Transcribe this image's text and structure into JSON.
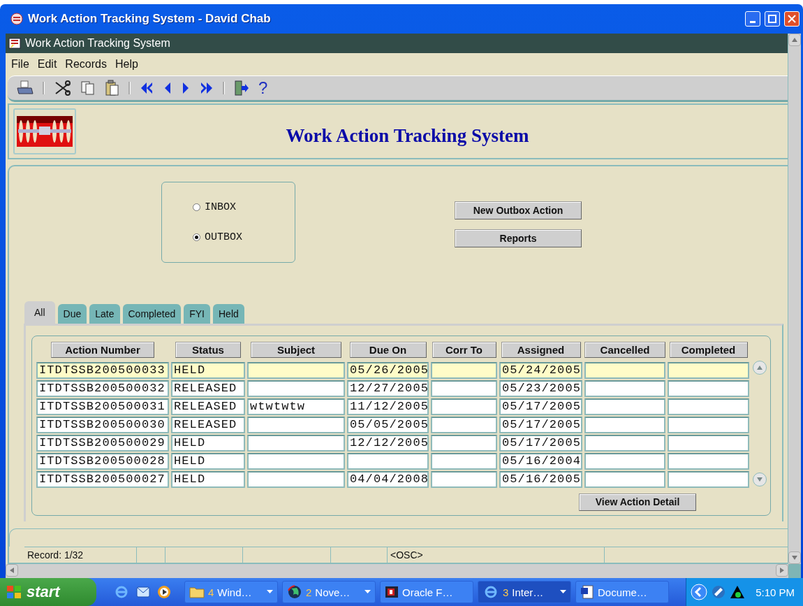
{
  "window": {
    "title": "Work Action Tracking System - David Chab"
  },
  "inner_window": {
    "title": "Work Action Tracking System"
  },
  "menu": [
    "File",
    "Edit",
    "Records",
    "Help"
  ],
  "toolbar": [
    {
      "kind": "print"
    },
    {
      "kind": "separator"
    },
    {
      "kind": "cut"
    },
    {
      "kind": "copy"
    },
    {
      "kind": "paste"
    },
    {
      "kind": "separator"
    },
    {
      "kind": "first"
    },
    {
      "kind": "previous"
    },
    {
      "kind": "next"
    },
    {
      "kind": "last"
    },
    {
      "kind": "separator"
    },
    {
      "kind": "exit"
    },
    {
      "kind": "help",
      "glyph": "?"
    }
  ],
  "header": {
    "title": "Work Action Tracking System"
  },
  "mailbox": [
    {
      "label": "INBOX",
      "selected": false
    },
    {
      "label": "OUTBOX",
      "selected": true
    }
  ],
  "action_buttons": [
    "New Outbox Action",
    "Reports"
  ],
  "tabs": [
    {
      "label": "All",
      "selected": true
    },
    {
      "label": "Due",
      "selected": false
    },
    {
      "label": "Late",
      "selected": false
    },
    {
      "label": "Completed",
      "selected": false
    },
    {
      "label": "FYI",
      "selected": false
    },
    {
      "label": "Held",
      "selected": false
    }
  ],
  "table": {
    "columns": [
      "Action Number",
      "Status",
      "Subject",
      "Due On",
      "Corr To",
      "Assigned",
      "Cancelled",
      "Completed"
    ],
    "rows": [
      {
        "selected": true,
        "cells": [
          "ITDTSSB200500033",
          "HELD",
          null,
          "05/26/2005",
          null,
          "05/24/2005",
          null,
          null
        ]
      },
      {
        "selected": false,
        "cells": [
          "ITDTSSB200500032",
          "RELEASED",
          null,
          "12/27/2005",
          null,
          "05/23/2005",
          null,
          null
        ]
      },
      {
        "selected": false,
        "cells": [
          "ITDTSSB200500031",
          "RELEASED",
          "wtwtwtw",
          "11/12/2005",
          null,
          "05/17/2005",
          null,
          null
        ]
      },
      {
        "selected": false,
        "cells": [
          "ITDTSSB200500030",
          "RELEASED",
          null,
          "05/05/2005",
          null,
          "05/17/2005",
          null,
          null
        ]
      },
      {
        "selected": false,
        "cells": [
          "ITDTSSB200500029",
          "HELD",
          null,
          "12/12/2005",
          null,
          "05/17/2005",
          null,
          null
        ]
      },
      {
        "selected": false,
        "cells": [
          "ITDTSSB200500028",
          "HELD",
          null,
          null,
          null,
          "05/16/2004",
          null,
          null
        ]
      },
      {
        "selected": false,
        "cells": [
          "ITDTSSB200500027",
          "HELD",
          null,
          "04/04/2008",
          null,
          "05/16/2005",
          null,
          null
        ]
      }
    ]
  },
  "detail_button": "View Action Detail",
  "status_bar": {
    "record": "Record: 1/32",
    "field_6": "<OSC>"
  },
  "taskbar": {
    "start": "start",
    "quick_launch": [
      {
        "kind": "browser"
      },
      {
        "kind": "email"
      },
      {
        "kind": "media"
      }
    ],
    "tasks": [
      {
        "kind": "folder",
        "count": "4",
        "label": "Wind…",
        "grouped": true,
        "selected": false
      },
      {
        "kind": "globe",
        "count": "2",
        "label": "Nove…",
        "grouped": true,
        "selected": false
      },
      {
        "kind": "app",
        "label": "Oracle F…",
        "grouped": false,
        "selected": false
      },
      {
        "kind": "browser",
        "count": "3",
        "label": "Inter…",
        "grouped": true,
        "selected": true
      },
      {
        "kind": "document",
        "label": "Docume…",
        "grouped": false,
        "selected": false
      }
    ],
    "clock": "5:10 PM"
  }
}
